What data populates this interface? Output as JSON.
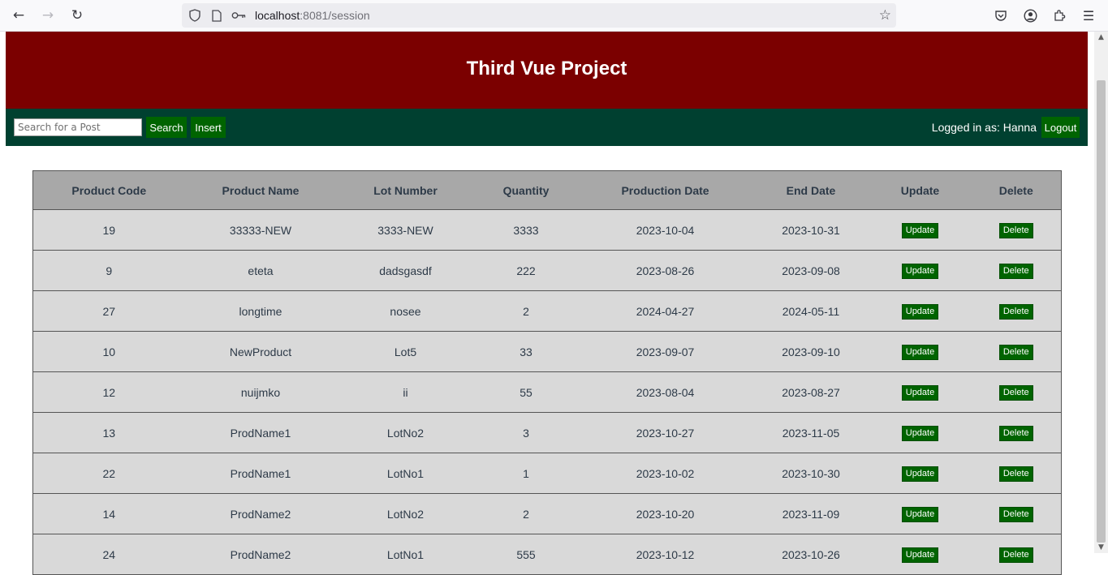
{
  "browser": {
    "url_host": "localhost",
    "url_rest": ":8081/session"
  },
  "header": {
    "title": "Third Vue Project"
  },
  "toolbar": {
    "search_placeholder": "Search for a Post",
    "search_label": "Search",
    "insert_label": "Insert",
    "logged_in_text": "Logged in as: Hanna",
    "logout_label": "Logout"
  },
  "table": {
    "columns": [
      "Product Code",
      "Product Name",
      "Lot Number",
      "Quantity",
      "Production Date",
      "End Date",
      "Update",
      "Delete"
    ],
    "update_label": "Update",
    "delete_label": "Delete",
    "rows": [
      {
        "code": "19",
        "name": "33333-NEW",
        "lot": "3333-NEW",
        "qty": "3333",
        "prod_date": "2023-10-04",
        "end_date": "2023-10-31"
      },
      {
        "code": "9",
        "name": "eteta",
        "lot": "dadsgasdf",
        "qty": "222",
        "prod_date": "2023-08-26",
        "end_date": "2023-09-08"
      },
      {
        "code": "27",
        "name": "longtime",
        "lot": "nosee",
        "qty": "2",
        "prod_date": "2024-04-27",
        "end_date": "2024-05-11"
      },
      {
        "code": "10",
        "name": "NewProduct",
        "lot": "Lot5",
        "qty": "33",
        "prod_date": "2023-09-07",
        "end_date": "2023-09-10"
      },
      {
        "code": "12",
        "name": "nuijmko",
        "lot": "ii",
        "qty": "55",
        "prod_date": "2023-08-04",
        "end_date": "2023-08-27"
      },
      {
        "code": "13",
        "name": "ProdName1",
        "lot": "LotNo2",
        "qty": "3",
        "prod_date": "2023-10-27",
        "end_date": "2023-11-05"
      },
      {
        "code": "22",
        "name": "ProdName1",
        "lot": "LotNo1",
        "qty": "1",
        "prod_date": "2023-10-02",
        "end_date": "2023-10-30"
      },
      {
        "code": "14",
        "name": "ProdName2",
        "lot": "LotNo2",
        "qty": "2",
        "prod_date": "2023-10-20",
        "end_date": "2023-11-09"
      },
      {
        "code": "24",
        "name": "ProdName2",
        "lot": "LotNo1",
        "qty": "555",
        "prod_date": "2023-10-12",
        "end_date": "2023-10-26"
      }
    ]
  },
  "colors": {
    "header_bg": "#7b0000",
    "toolbar_bg": "#004030",
    "button_bg": "#006400",
    "table_header_bg": "#a8a8a8",
    "table_row_bg": "#d9d9d9"
  }
}
